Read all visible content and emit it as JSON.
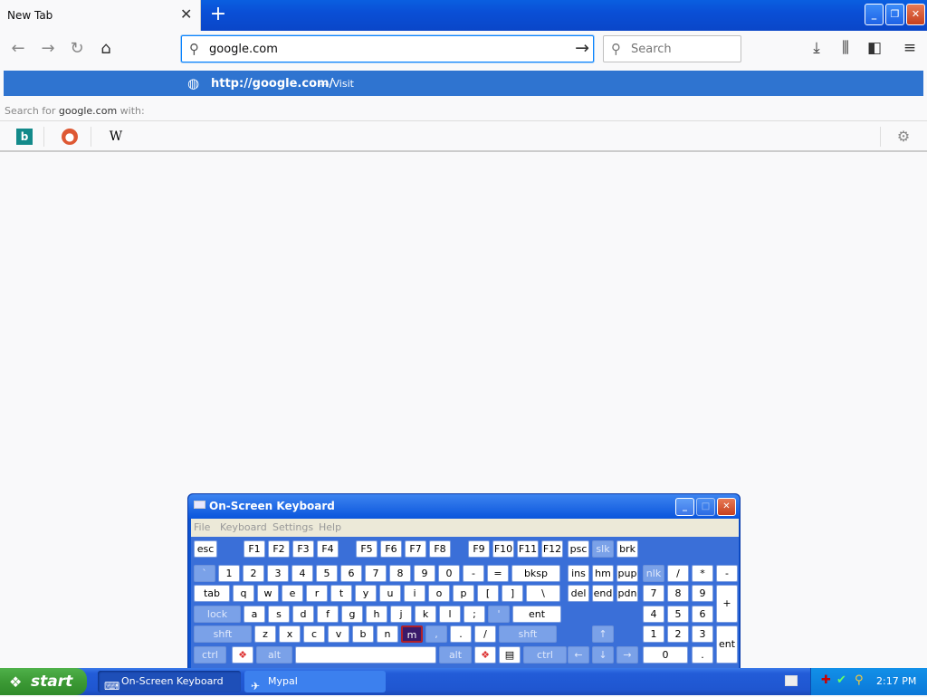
{
  "browser": {
    "tab_title": "New Tab",
    "tab_close": "✕",
    "new_tab": "+",
    "url_value": "google.com",
    "search_placeholder": "Search",
    "suggestion": {
      "url": "http://google.com/",
      "action": "— Visit"
    },
    "search_with_prefix": "Search for ",
    "search_with_term": "google.com",
    "search_with_suffix": " with:",
    "engines": [
      "Bing",
      "DuckDuckGo",
      "Wikipedia"
    ]
  },
  "osk": {
    "title": "On-Screen Keyboard",
    "menu": [
      "File",
      "Keyboard",
      "Settings",
      "Help"
    ],
    "rows": [
      [
        {
          "l": "esc"
        },
        {
          "l": "F1"
        },
        {
          "l": "F2"
        },
        {
          "l": "F3"
        },
        {
          "l": "F4"
        },
        {
          "l": "F5"
        },
        {
          "l": "F6"
        },
        {
          "l": "F7"
        },
        {
          "l": "F8"
        },
        {
          "l": "F9"
        },
        {
          "l": "F10"
        },
        {
          "l": "F11"
        },
        {
          "l": "F12"
        },
        {
          "l": "psc"
        },
        {
          "l": "slk",
          "m": true
        },
        {
          "l": "brk"
        }
      ],
      [
        {
          "l": "`",
          "m": true
        },
        {
          "l": "1"
        },
        {
          "l": "2"
        },
        {
          "l": "3"
        },
        {
          "l": "4"
        },
        {
          "l": "5"
        },
        {
          "l": "6"
        },
        {
          "l": "7"
        },
        {
          "l": "8"
        },
        {
          "l": "9"
        },
        {
          "l": "0"
        },
        {
          "l": "-"
        },
        {
          "l": "="
        },
        {
          "l": "bksp"
        },
        {
          "l": "ins"
        },
        {
          "l": "hm"
        },
        {
          "l": "pup"
        },
        {
          "l": "nlk",
          "m": true
        },
        {
          "l": "/"
        },
        {
          "l": "*"
        },
        {
          "l": "-"
        }
      ],
      [
        {
          "l": "tab"
        },
        {
          "l": "q"
        },
        {
          "l": "w"
        },
        {
          "l": "e"
        },
        {
          "l": "r"
        },
        {
          "l": "t"
        },
        {
          "l": "y"
        },
        {
          "l": "u"
        },
        {
          "l": "i"
        },
        {
          "l": "o"
        },
        {
          "l": "p"
        },
        {
          "l": "["
        },
        {
          "l": "]"
        },
        {
          "l": "\\"
        },
        {
          "l": "del"
        },
        {
          "l": "end"
        },
        {
          "l": "pdn"
        },
        {
          "l": "7"
        },
        {
          "l": "8"
        },
        {
          "l": "9"
        },
        {
          "l": "+"
        }
      ],
      [
        {
          "l": "lock",
          "m": true
        },
        {
          "l": "a"
        },
        {
          "l": "s"
        },
        {
          "l": "d"
        },
        {
          "l": "f"
        },
        {
          "l": "g"
        },
        {
          "l": "h"
        },
        {
          "l": "j"
        },
        {
          "l": "k"
        },
        {
          "l": "l"
        },
        {
          "l": ";"
        },
        {
          "l": "'",
          "m": true
        },
        {
          "l": "ent"
        },
        {
          "l": "4"
        },
        {
          "l": "5"
        },
        {
          "l": "6"
        }
      ],
      [
        {
          "l": "shft",
          "m": true
        },
        {
          "l": "z"
        },
        {
          "l": "x"
        },
        {
          "l": "c"
        },
        {
          "l": "v"
        },
        {
          "l": "b"
        },
        {
          "l": "n"
        },
        {
          "l": "m",
          "sel": true
        },
        {
          "l": ",",
          "m": true
        },
        {
          "l": "."
        },
        {
          "l": "/"
        },
        {
          "l": "shft",
          "m": true
        },
        {
          "l": "↑",
          "m": true
        },
        {
          "l": "1"
        },
        {
          "l": "2"
        },
        {
          "l": "3"
        },
        {
          "l": "ent"
        }
      ],
      [
        {
          "l": "ctrl",
          "m": true
        },
        {
          "l": "win"
        },
        {
          "l": "alt",
          "m": true
        },
        {
          "l": ""
        },
        {
          "l": "alt",
          "m": true
        },
        {
          "l": "win"
        },
        {
          "l": "menu"
        },
        {
          "l": "ctrl",
          "m": true
        },
        {
          "l": "←",
          "m": true
        },
        {
          "l": "↓",
          "m": true
        },
        {
          "l": "→",
          "m": true
        },
        {
          "l": "0"
        },
        {
          "l": "."
        }
      ]
    ]
  },
  "taskbar": {
    "start": "start",
    "tasks": [
      "On-Screen Keyboard",
      "Mypal"
    ],
    "clock": "2:17 PM"
  },
  "colors": {
    "accent": "#0a84ff",
    "suggest": "#2f74d0",
    "xp_blue": "#225cd8",
    "start_green": "#3c9a35"
  }
}
